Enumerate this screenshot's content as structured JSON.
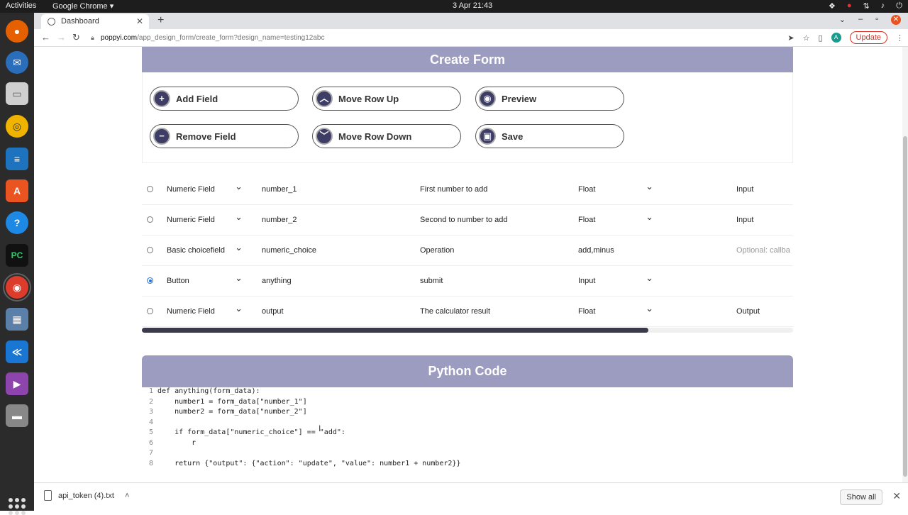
{
  "system_bar": {
    "activities": "Activities",
    "app_name": "Google Chrome ▾",
    "clock": "3 Apr  21:43",
    "tray_icons": [
      "dropbox-icon",
      "record-icon",
      "network-icon",
      "volume-icon",
      "power-icon"
    ]
  },
  "dock": {
    "apps": [
      "firefox-icon",
      "thunderbird-icon",
      "files-icon",
      "rhythmbox-icon",
      "writer-icon",
      "app-center-icon",
      "help-icon",
      "pycharm-icon",
      "chrome-icon",
      "screenshot-icon",
      "vscode-icon",
      "video-icon",
      "drive-icon"
    ],
    "pycharm_label": "PC",
    "help_label": "?"
  },
  "browser": {
    "tab_title": "Dashboard",
    "tab_close": "✕",
    "new_tab": "+",
    "url_host": "poppyi.com",
    "url_path": "/app_design_form/create_form?design_name=testing12abc",
    "update_label": "Update",
    "avatar_letter": "A"
  },
  "create_form": {
    "title": "Create Form",
    "buttons": [
      {
        "label": "Add Field",
        "icon": "plus-icon",
        "glyph": "+"
      },
      {
        "label": "Move Row Up",
        "icon": "chevron-up-icon",
        "glyph": "︿"
      },
      {
        "label": "Preview",
        "icon": "eye-icon",
        "glyph": "◉"
      },
      {
        "label": "Remove Field",
        "icon": "minus-icon",
        "glyph": "−"
      },
      {
        "label": "Move Row Down",
        "icon": "chevron-down-icon",
        "glyph": "﹀"
      },
      {
        "label": "Save",
        "icon": "save-icon",
        "glyph": "▣"
      }
    ]
  },
  "fields": [
    {
      "selected": false,
      "type": "Numeric Field",
      "name": "number_1",
      "label": "First number to add",
      "data_type": "Float",
      "io": "Input"
    },
    {
      "selected": false,
      "type": "Numeric Field",
      "name": "number_2",
      "label": "Second to number to add",
      "data_type": "Float",
      "io": "Input"
    },
    {
      "selected": false,
      "type": "Basic choicefield",
      "name": "numeric_choice",
      "label": "Operation",
      "data_type": "add,minus",
      "io_placeholder": "Optional: callba"
    },
    {
      "selected": true,
      "type": "Button",
      "name": "anything",
      "label": "submit",
      "data_type": "Input",
      "io": ""
    },
    {
      "selected": false,
      "type": "Numeric Field",
      "name": "output",
      "label": "The calculator result",
      "data_type": "Float",
      "io": "Output"
    }
  ],
  "python_code": {
    "title": "Python Code",
    "lines": [
      {
        "n": "1",
        "text": "def anything(form_data):"
      },
      {
        "n": "2",
        "text": "    number1 = form_data[\"number_1\"]"
      },
      {
        "n": "3",
        "text": "    number2 = form_data[\"number_2\"]"
      },
      {
        "n": "4",
        "text": ""
      },
      {
        "n": "5",
        "text": "    if form_data[\"numeric_choice\"] == \"add\":"
      },
      {
        "n": "6",
        "text": "        r"
      },
      {
        "n": "7",
        "text": ""
      },
      {
        "n": "8",
        "text": "    return {\"output\": {\"action\": \"update\", \"value\": number1 + number2}}"
      }
    ]
  },
  "downloads": {
    "file": "api_token (4).txt",
    "show_all": "Show all",
    "close": "✕"
  },
  "colors": {
    "header_bg": "#9c9cc0",
    "icon_bg": "#3d3d66",
    "accent_red": "#d93025"
  }
}
